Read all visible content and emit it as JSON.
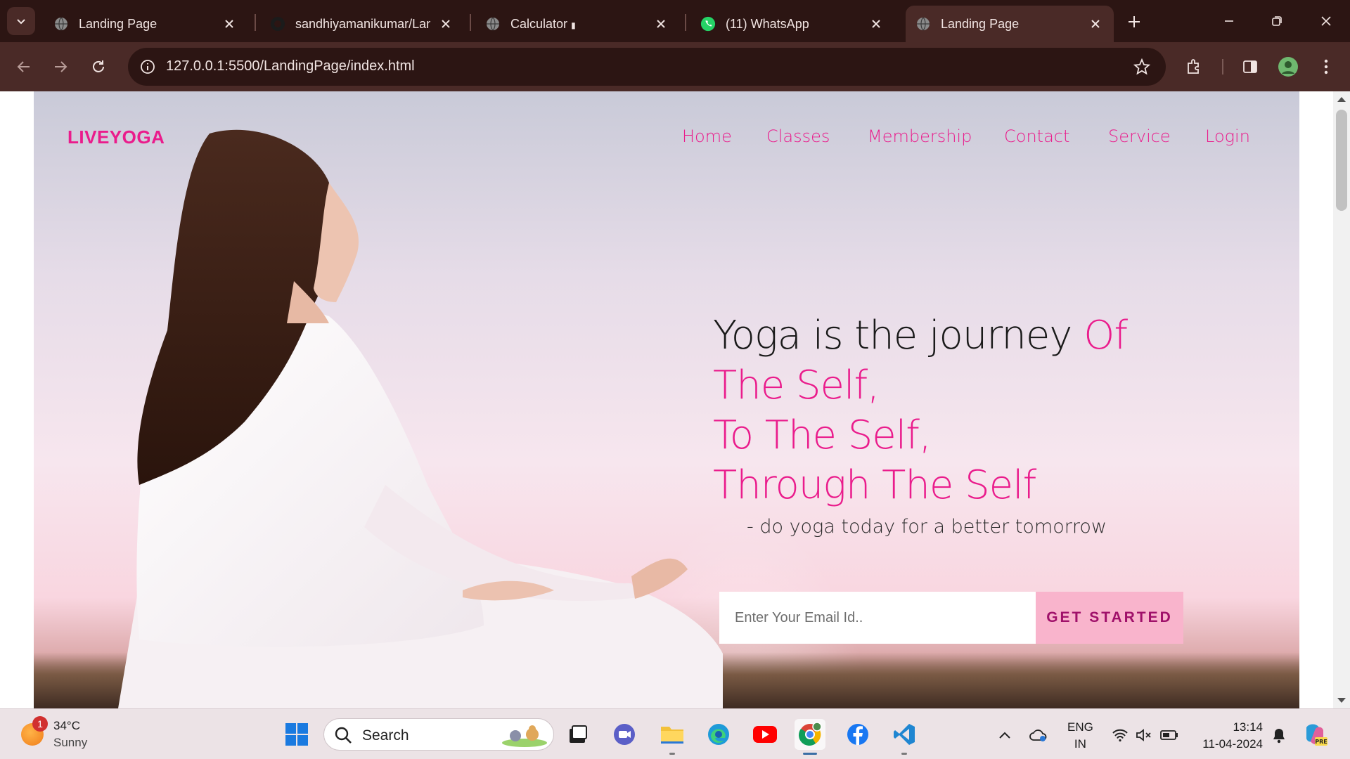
{
  "browser": {
    "tabs": [
      {
        "title": "Landing Page",
        "favicon": "globe-icon",
        "active": false
      },
      {
        "title": "sandhiyamanikumar/Landin",
        "favicon": "github-icon",
        "active": false
      },
      {
        "title": "Calculator",
        "favicon": "globe-icon",
        "active": false,
        "indicator": "▮"
      },
      {
        "title": "(11) WhatsApp",
        "favicon": "whatsapp-icon",
        "active": false
      },
      {
        "title": "Landing Page",
        "favicon": "globe-icon",
        "active": true
      }
    ],
    "url": "127.0.0.1:5500/LandingPage/index.html"
  },
  "site": {
    "brand": "LIVEYOGA",
    "nav": [
      "Home",
      "Classes",
      "Membership",
      "Contact",
      "Service",
      "Login"
    ],
    "headline": {
      "dark": "Yoga is the journey ",
      "pink_inline": "Of",
      "line2": "The Self,",
      "line3": "To The Self,",
      "line4": "Through The Self"
    },
    "tagline": "- do yoga today for a better tomorrow",
    "email_placeholder": "Enter Your Email Id..",
    "cta": "GET STARTED",
    "colors": {
      "accent": "#ea1c8c",
      "cta_bg": "#f9b4cc"
    }
  },
  "taskbar": {
    "weather": {
      "temp": "34°C",
      "condition": "Sunny",
      "badge": "1"
    },
    "search_label": "Search",
    "apps": [
      "windows-start-icon",
      "task-view-icon",
      "meet-icon",
      "file-explorer-icon",
      "edge-icon",
      "youtube-icon",
      "chrome-icon",
      "facebook-icon",
      "vscode-icon"
    ],
    "language": {
      "line1": "ENG",
      "line2": "IN"
    },
    "time": "13:14",
    "date": "11-04-2024"
  }
}
